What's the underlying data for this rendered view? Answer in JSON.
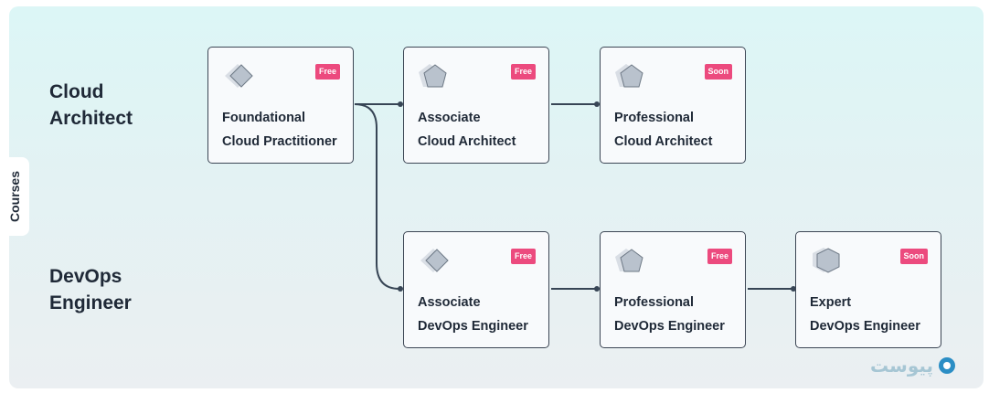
{
  "side_tab": {
    "label": "Courses"
  },
  "tracks": [
    {
      "id": "cloud",
      "label_lines": [
        "Cloud",
        "Architect"
      ]
    },
    {
      "id": "devops",
      "label_lines": [
        "DevOps",
        "Engineer"
      ]
    }
  ],
  "cards": [
    {
      "id": "foundational",
      "icon": "diamond-icon",
      "badge": "Free",
      "badge_color": "#ec4a7e",
      "lines": [
        "Foundational",
        "Cloud Practitioner"
      ]
    },
    {
      "id": "associate-ca",
      "icon": "pentagon-icon",
      "badge": "Free",
      "badge_color": "#ec4a7e",
      "lines": [
        "Associate",
        "Cloud Architect"
      ]
    },
    {
      "id": "professional-ca",
      "icon": "pentagon-icon",
      "badge": "Soon",
      "badge_color": "#ec4a7e",
      "lines": [
        "Professional",
        "Cloud Architect"
      ]
    },
    {
      "id": "associate-devops",
      "icon": "diamond-icon",
      "badge": "Free",
      "badge_color": "#ec4a7e",
      "lines": [
        "Associate",
        "DevOps Engineer"
      ]
    },
    {
      "id": "professional-devops",
      "icon": "pentagon-icon",
      "badge": "Free",
      "badge_color": "#ec4a7e",
      "lines": [
        "Professional",
        "DevOps Engineer"
      ]
    },
    {
      "id": "expert-devops",
      "icon": "hexagon-icon",
      "badge": "Soon",
      "badge_color": "#ec4a7e",
      "lines": [
        "Expert",
        "DevOps Engineer"
      ]
    }
  ],
  "connections": [
    {
      "from": "foundational",
      "to": "associate-ca"
    },
    {
      "from": "associate-ca",
      "to": "professional-ca"
    },
    {
      "from": "foundational",
      "to": "associate-devops"
    },
    {
      "from": "associate-devops",
      "to": "professional-devops"
    },
    {
      "from": "professional-devops",
      "to": "expert-devops"
    }
  ],
  "watermark": {
    "text": "پیوست",
    "icon": "logo-icon"
  },
  "colors": {
    "badge": "#ec4a7e",
    "connector": "#374555",
    "card_border": "#3c4654"
  }
}
